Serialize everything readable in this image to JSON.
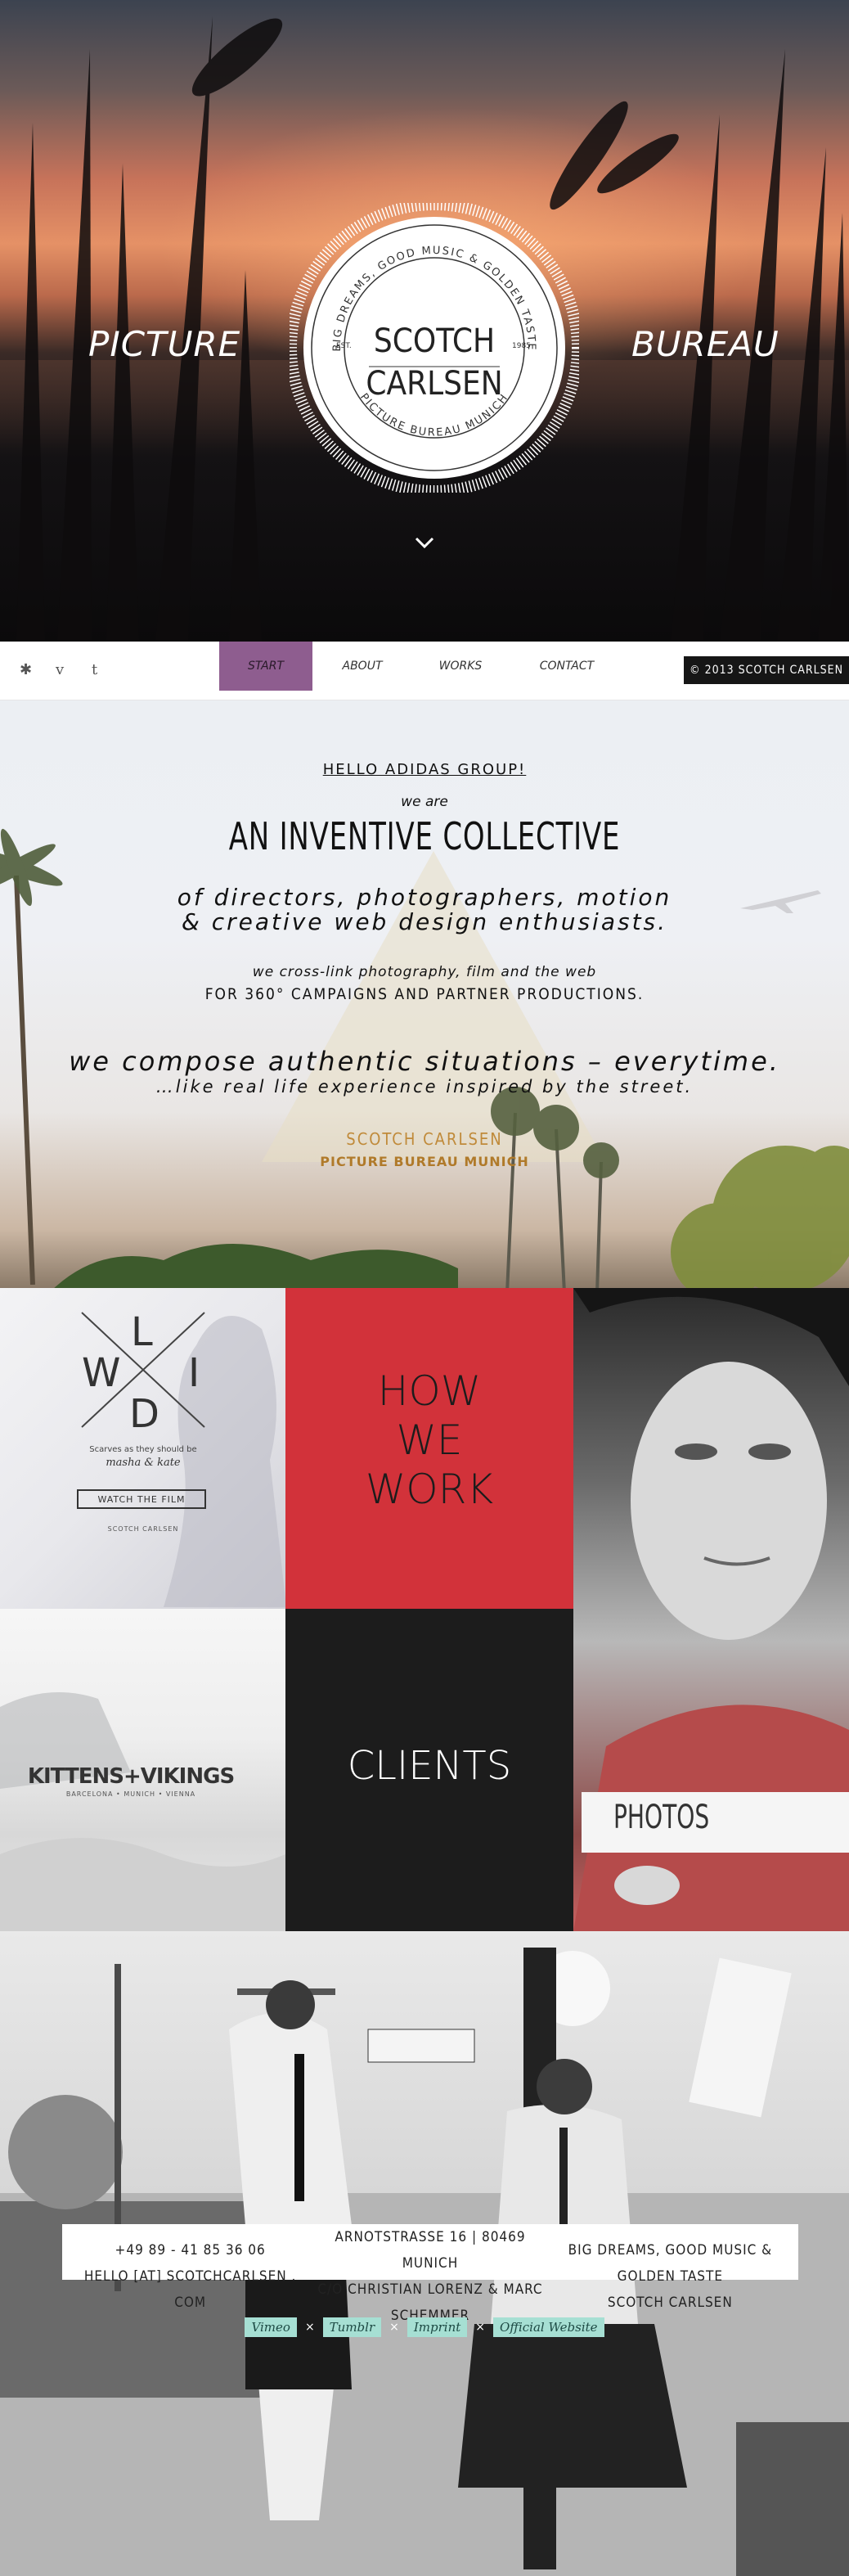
{
  "hero": {
    "left_word": "PICTURE",
    "right_word": "BUREAU",
    "badge": {
      "top_arc": "BIG DREAMS, GOOD MUSIC & GOLDEN TASTE",
      "bottom_arc": "PICTURE BUREAU MUNICH",
      "name_line1": "SCOTCH",
      "name_line2": "CARLSEN",
      "est": "EST.",
      "year": "1985"
    },
    "scroll_icon": "chevron-down-icon"
  },
  "nav": {
    "social": [
      {
        "icon": "asterisk-icon",
        "glyph": "✱"
      },
      {
        "icon": "vimeo-icon",
        "glyph": "v"
      },
      {
        "icon": "tumblr-icon",
        "glyph": "t"
      }
    ],
    "items": [
      {
        "label": "START",
        "active": true
      },
      {
        "label": "ABOUT"
      },
      {
        "label": "WORKS"
      },
      {
        "label": "CONTACT"
      }
    ],
    "copyright": "© 2013 SCOTCH CARLSEN",
    "active_color": "#8e5d8f"
  },
  "intro": {
    "hello": "HELLO ADIDAS GROUP!",
    "we_are": "we are",
    "headline": "AN INVENTIVE COLLECTIVE",
    "directors_line1": "of directors, photographers, motion",
    "directors_line2": "& creative web design enthusiasts.",
    "crosslink": "we cross-link photography, film and the web",
    "campaigns": "FOR 360° CAMPAIGNS AND PARTNER PRODUCTIONS.",
    "compose": "we compose authentic situations – everytime.",
    "street": "…like real life experience inspired by the street.",
    "signature_line1": "SCOTCH CARLSEN",
    "signature_line2": "PICTURE BUREAU MUNICH"
  },
  "tiles": {
    "wild": {
      "letters": [
        "W",
        "I",
        "L",
        "D"
      ],
      "caption": "Scarves as they should be",
      "script": "masha & kate",
      "button": "WATCH THE FILM",
      "credit": "SCOTCH CARLSEN"
    },
    "how": {
      "line1": "HOW",
      "line2": "WE",
      "line3": "WORK",
      "color": "#d2323a"
    },
    "kittens": {
      "title": "KITTENS+VIKINGS",
      "subtitle": "BARCELONA • MUNICH • VIENNA"
    },
    "clients": {
      "label": "CLIENTS"
    },
    "photos": {
      "label": "PHOTOS"
    }
  },
  "footer": {
    "phone": "+49 89 - 41 85 36 06",
    "email": "HELLO [AT] SCOTCHCARLSEN . COM",
    "address": "ARNOTSTRASSE 16 | 80469 MUNICH",
    "co": "C/O CHRISTIAN LORENZ & MARC SCHEMMER",
    "tagline": "BIG DREAMS, GOOD MUSIC & GOLDEN TASTE",
    "name": "SCOTCH CARLSEN",
    "links": [
      "Vimeo",
      "Tumblr",
      "Imprint",
      "Official Website"
    ],
    "sep": "×",
    "link_color": "#a6dfd3"
  }
}
